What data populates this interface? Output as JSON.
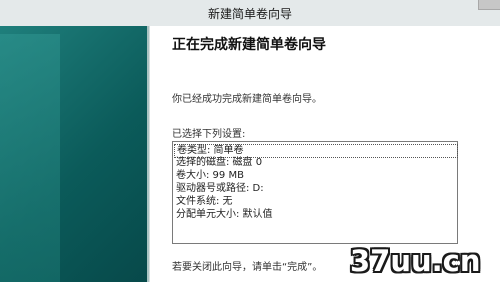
{
  "window": {
    "title": "新建简单卷向导"
  },
  "page": {
    "heading": "正在完成新建简单卷向导",
    "success_message": "你已经成功完成新建简单卷向导。",
    "settings_label": "已选择下列设置:",
    "settings": [
      "卷类型: 简单卷",
      "选择的磁盘: 磁盘 0",
      "卷大小: 99 MB",
      "驱动器号或路径: D:",
      "文件系统: 无",
      "分配单元大小: 默认值"
    ],
    "selected_setting_index": 0,
    "close_hint": "若要关闭此向导，请单击“完成”。"
  },
  "watermark": {
    "text": "37uu.cn"
  },
  "colors": {
    "sidebar": "#0b5b5a",
    "titlebar": "#e4e9ea"
  }
}
